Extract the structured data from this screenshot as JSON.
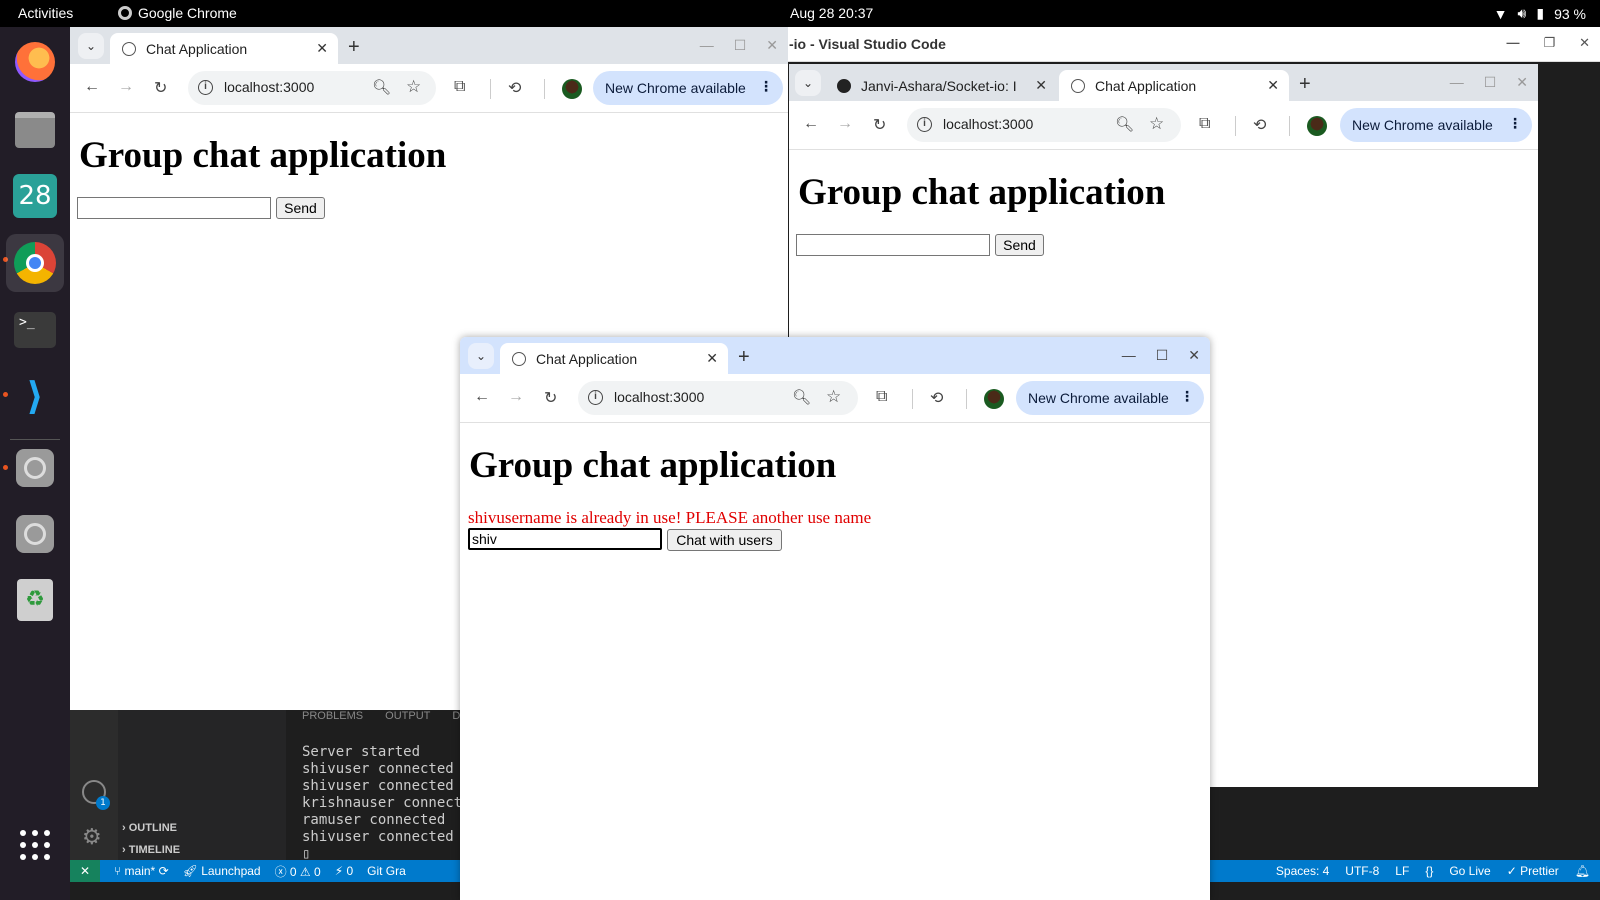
{
  "topbar": {
    "activities": "Activities",
    "app_name": "Google Chrome",
    "datetime": "Aug 28  20:37",
    "battery": "93 %"
  },
  "dock": {
    "calendar_day": "28"
  },
  "vscode": {
    "title": "-io - Visual Studio Code",
    "panel_tabs": [
      "PROBLEMS",
      "OUTPUT",
      "DE"
    ],
    "terminal_lines": [
      "Server started",
      "shivuser connected",
      "shivuser connected",
      "krishnauser connected",
      "ramuser connected",
      "shivuser connected"
    ],
    "sidebar_sections": [
      "OUTLINE",
      "TIMELINE"
    ],
    "badge": "1",
    "status_left": [
      "main*",
      "Launchpad",
      "ⓧ 0 ⚠ 0",
      "⚡ 0",
      "Git Gra"
    ],
    "status_right": [
      "Spaces: 4",
      "UTF-8",
      "LF",
      "{}",
      "Go Live",
      "✓ Prettier"
    ]
  },
  "window1": {
    "tab_title": "Chat Application",
    "url": "localhost:3000",
    "update_label": "New Chrome available",
    "heading": "Group chat application",
    "input_value": "",
    "button_label": "Send"
  },
  "window2": {
    "tab1_title": "Janvi-Ashara/Socket-io: I",
    "tab2_title": "Chat Application",
    "url": "localhost:3000",
    "update_label": "New Chrome available",
    "heading": "Group chat application",
    "input_value": "",
    "button_label": "Send"
  },
  "window3": {
    "tab_title": "Chat Application",
    "url": "localhost:3000",
    "update_label": "New Chrome available",
    "heading": "Group chat application",
    "error_message": "shivusername is already in use! PLEASE another use name",
    "input_value": "shiv",
    "button_label": "Chat with users",
    "error_color": "#e00000"
  }
}
